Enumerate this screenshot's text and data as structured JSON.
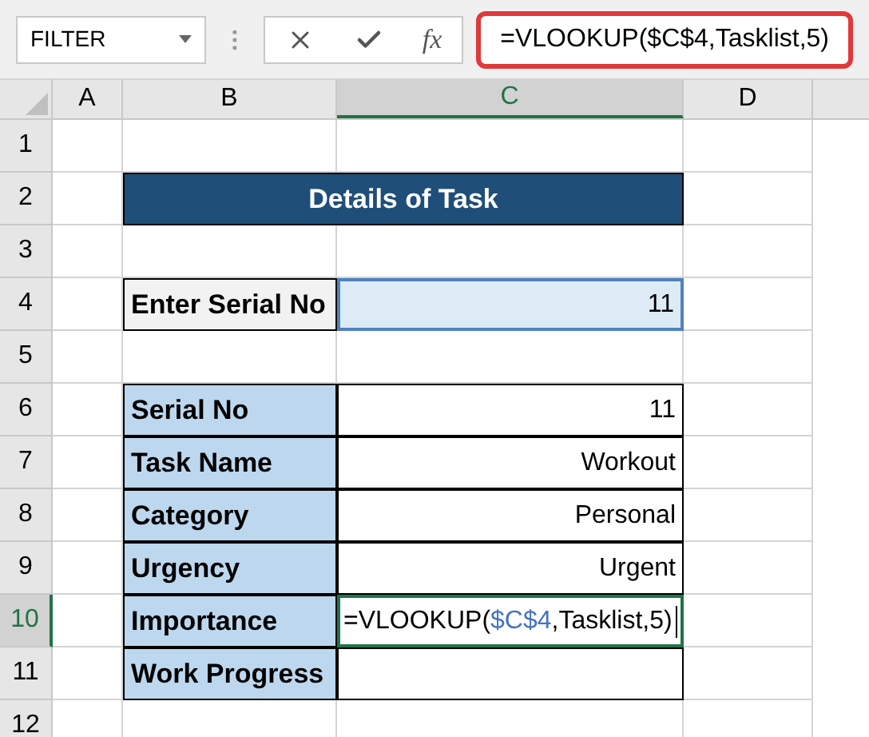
{
  "name_box": {
    "value": "FILTER"
  },
  "formula_bar": {
    "function_label": "fx",
    "value": "=VLOOKUP($C$4,Tasklist,5)"
  },
  "columns": [
    {
      "label": "A",
      "selected": false
    },
    {
      "label": "B",
      "selected": false
    },
    {
      "label": "C",
      "selected": true
    },
    {
      "label": "D",
      "selected": false
    }
  ],
  "rows": [
    {
      "label": "1",
      "selected": false
    },
    {
      "label": "2",
      "selected": false
    },
    {
      "label": "3",
      "selected": false
    },
    {
      "label": "4",
      "selected": false
    },
    {
      "label": "5",
      "selected": false
    },
    {
      "label": "6",
      "selected": false
    },
    {
      "label": "7",
      "selected": false
    },
    {
      "label": "8",
      "selected": false
    },
    {
      "label": "9",
      "selected": false
    },
    {
      "label": "10",
      "selected": true
    },
    {
      "label": "11",
      "selected": false
    },
    {
      "label": "12",
      "selected": false
    }
  ],
  "title": "Details of Task",
  "input": {
    "label": "Enter Serial No",
    "value": "11",
    "selected": true
  },
  "details": [
    {
      "label": "Serial No",
      "value": "11"
    },
    {
      "label": "Task Name",
      "value": "Workout"
    },
    {
      "label": "Category",
      "value": "Personal"
    },
    {
      "label": "Urgency",
      "value": "Urgent"
    },
    {
      "label": "Importance",
      "editing": true,
      "parts": [
        {
          "text": "=VLOOKUP(",
          "kind": "plain"
        },
        {
          "text": "$C$4",
          "kind": "reference"
        },
        {
          "text": ",Tasklist,5)",
          "kind": "plain"
        }
      ]
    },
    {
      "label": "Work Progress"
    }
  ]
}
